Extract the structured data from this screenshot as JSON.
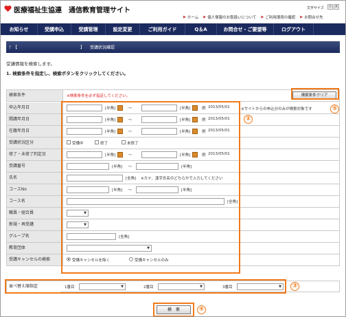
{
  "header": {
    "site_title": "医療福祉生協連　通信教育管理サイト",
    "font_size_label": "文字サイズ",
    "font_small": "小",
    "font_large": "大",
    "links": [
      "ホーム",
      "個人情報のお取扱いについて",
      "ご利用環境の確認",
      "お問合せ先"
    ]
  },
  "nav": [
    "お知らせ",
    "受講申込",
    "受講管理",
    "設定変更",
    "ご利用ガイド",
    "Q＆A",
    "お問合せ・ご要望等",
    "ログアウト"
  ],
  "page_heading": {
    "prefix": "！【",
    "suffix": "】",
    "title": "受講状況確認"
  },
  "intro": "受講情報を検索します。",
  "step1": "1. 検索条件を指定し、検索ボタンをクリックしてください。",
  "form": {
    "header_label": "検索条件",
    "required_note": "※検索条件を必ず指定してください。",
    "clear_button": "検索条件クリア",
    "side_note": "※サイトからの申込分のみが検索対象です",
    "half_width": "[半角]",
    "full_width": "[全角]",
    "tilde": "～",
    "example": "例",
    "example_date": "2013/05/01",
    "rows": {
      "apply_date": "申込年月日",
      "start_date": "開講年月日",
      "enroll_date": "在籍年月日",
      "status": "受講状況区分",
      "status_options": [
        "受講中",
        "修了",
        "未修了"
      ],
      "finish_date": "修了・未修了判定日",
      "student_no": "受講番号",
      "name": "氏名",
      "name_note": "※カナ、漢字氏名のどちらかで入力してください",
      "course_no": "コースNo",
      "course_name": "コース名",
      "staff_member": "職員・組合員",
      "new_renew": "新規・再受講",
      "group_name": "グループ名",
      "education_org": "教育団体",
      "cancel_search": "受講キャンセルの検索",
      "cancel_options": [
        "受講キャンセルを除く",
        "受講キャンセルのみ"
      ]
    }
  },
  "sort": {
    "label": "並べ替え順指定",
    "first": "1番目",
    "second": "2番目",
    "third": "3番目"
  },
  "search_button": "検　索",
  "callouts": [
    "②",
    "③",
    "④",
    "⑤"
  ],
  "colors": {
    "nav_bg": "#1b2a5e",
    "highlight": "#f07a1a",
    "required": "#e02020"
  }
}
